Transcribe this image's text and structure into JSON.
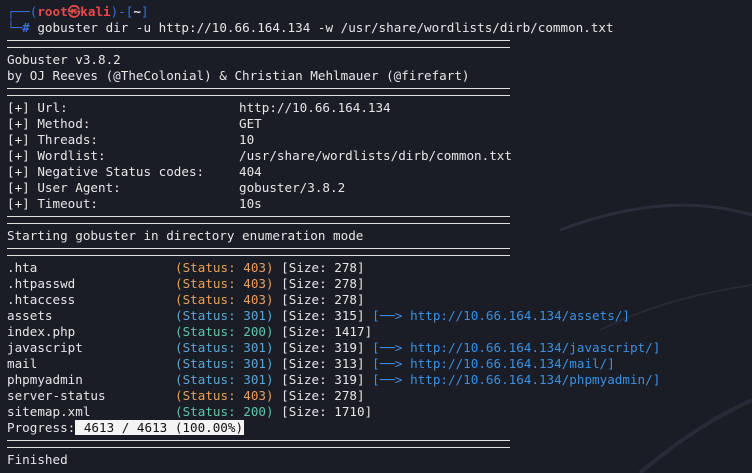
{
  "prompt": {
    "top_prefix": "┌──(",
    "user": "root",
    "at": "㉿",
    "host": "kali",
    "mid": ")-[",
    "dir": "~",
    "end": "]",
    "bottom_prefix": "└─",
    "symbol": "#",
    "command": " gobuster dir -u http://10.66.164.134 -w /usr/share/wordlists/dirb/common.txt"
  },
  "banner": {
    "version": "Gobuster v3.8.2",
    "authors": "by OJ Reeves (@TheColonial) & Christian Mehlmauer (@firefart)"
  },
  "config": [
    {
      "label": "[+] Url:",
      "value": "http://10.66.164.134"
    },
    {
      "label": "[+] Method:",
      "value": "GET"
    },
    {
      "label": "[+] Threads:",
      "value": "10"
    },
    {
      "label": "[+] Wordlist:",
      "value": "/usr/share/wordlists/dirb/common.txt"
    },
    {
      "label": "[+] Negative Status codes:",
      "value": "404"
    },
    {
      "label": "[+] User Agent:",
      "value": "gobuster/3.8.2"
    },
    {
      "label": "[+] Timeout:",
      "value": "10s"
    }
  ],
  "mode_text": "Starting gobuster in directory enumeration mode",
  "results": [
    {
      "path": ".hta",
      "status": "(Status: 403)",
      "code": "403",
      "size": "[Size: 278]",
      "redirect": ""
    },
    {
      "path": ".htpasswd",
      "status": "(Status: 403)",
      "code": "403",
      "size": "[Size: 278]",
      "redirect": ""
    },
    {
      "path": ".htaccess",
      "status": "(Status: 403)",
      "code": "403",
      "size": "[Size: 278]",
      "redirect": ""
    },
    {
      "path": "assets",
      "status": "(Status: 301)",
      "code": "301",
      "size": "[Size: 315]",
      "redirect": "[──> http://10.66.164.134/assets/]"
    },
    {
      "path": "index.php",
      "status": "(Status: 200)",
      "code": "200",
      "size": "[Size: 1417]",
      "redirect": ""
    },
    {
      "path": "javascript",
      "status": "(Status: 301)",
      "code": "301",
      "size": "[Size: 319]",
      "redirect": "[──> http://10.66.164.134/javascript/]"
    },
    {
      "path": "mail",
      "status": "(Status: 301)",
      "code": "301",
      "size": "[Size: 313]",
      "redirect": "[──> http://10.66.164.134/mail/]"
    },
    {
      "path": "phpmyadmin",
      "status": "(Status: 301)",
      "code": "301",
      "size": "[Size: 319]",
      "redirect": "[──> http://10.66.164.134/phpmyadmin/]"
    },
    {
      "path": "server-status",
      "status": "(Status: 403)",
      "code": "403",
      "size": "[Size: 278]",
      "redirect": ""
    },
    {
      "path": "sitemap.xml",
      "status": "(Status: 200)",
      "code": "200",
      "size": "[Size: 1710]",
      "redirect": ""
    }
  ],
  "progress": {
    "label": "Progress:",
    "value": " 4613 / 4613 (100.00%)"
  },
  "finished": "Finished",
  "colors": {
    "background": "#1a1d26",
    "s403": "#e8a05c",
    "s301": "#58a7d6",
    "s200": "#5fc6a8",
    "redirect": "#3d8fe0"
  }
}
